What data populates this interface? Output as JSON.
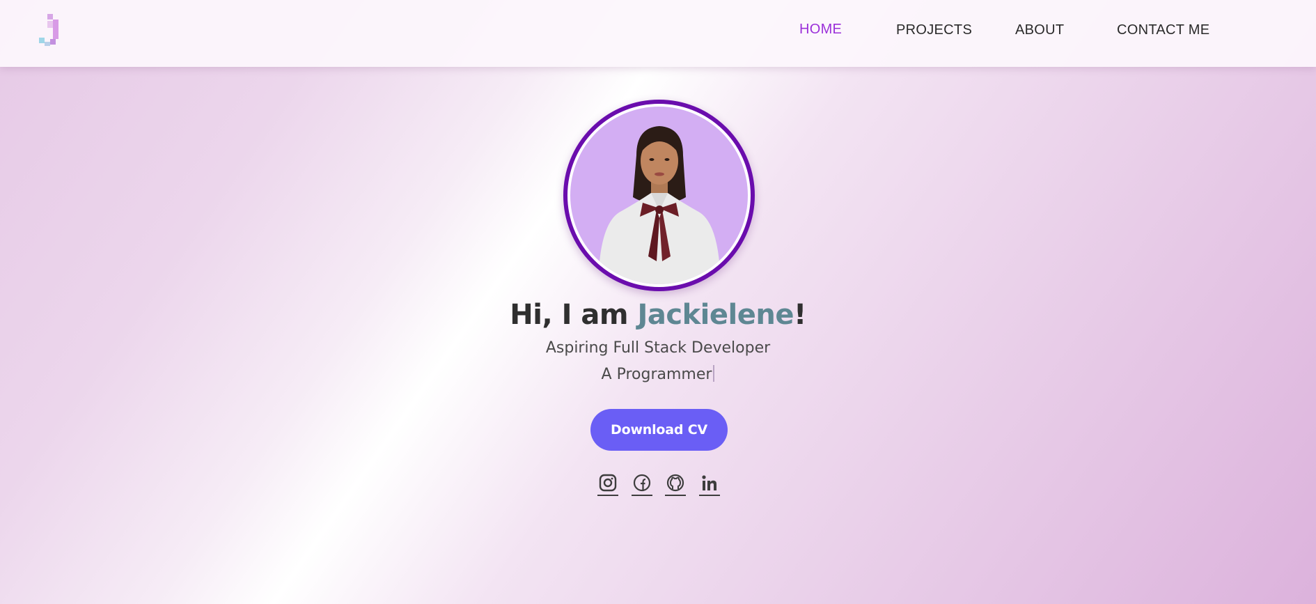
{
  "nav": {
    "logo_letter": "J",
    "items": [
      {
        "label": "HOME",
        "active": true
      },
      {
        "label": "PROJECTS",
        "active": false
      },
      {
        "label": "ABOUT",
        "active": false
      },
      {
        "label": "CONTACT ME",
        "active": false
      }
    ]
  },
  "hero": {
    "greeting_prefix": "Hi, I am ",
    "name": "Jackielene",
    "greeting_suffix": "!",
    "subtitle": "Aspiring Full Stack Developer",
    "typed_text": "A Programmer",
    "cv_button_label": "Download CV"
  },
  "socials": [
    {
      "name": "instagram",
      "icon": "instagram-icon"
    },
    {
      "name": "facebook",
      "icon": "facebook-icon"
    },
    {
      "name": "github",
      "icon": "github-icon"
    },
    {
      "name": "linkedin",
      "icon": "linkedin-icon"
    }
  ],
  "colors": {
    "accent": "#9b30d9",
    "name_color": "#5e8793",
    "button": "#6a5ef5",
    "avatar_ring": "#6a0dad",
    "avatar_bg": "#d3aef3"
  }
}
